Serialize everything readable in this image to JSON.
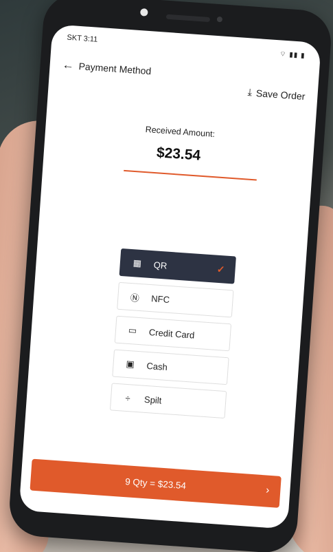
{
  "status_bar": {
    "carrier_time": "SKT 3:11",
    "icons": "⌔ ▮▮ ▮"
  },
  "header": {
    "title": "Payment Method",
    "save_order_label": "Save Order"
  },
  "amount": {
    "label": "Received Amount:",
    "value": "$23.54"
  },
  "methods": [
    {
      "label": "QR",
      "icon": "qr-icon",
      "selected": true
    },
    {
      "label": "NFC",
      "icon": "nfc-icon",
      "selected": false
    },
    {
      "label": "Credit Card",
      "icon": "credit-card-icon",
      "selected": false
    },
    {
      "label": "Cash",
      "icon": "cash-icon",
      "selected": false
    },
    {
      "label": "Spilt",
      "icon": "divide-icon",
      "selected": false
    }
  ],
  "checkout": {
    "label": "9 Qty = $23.54"
  },
  "colors": {
    "accent": "#e05a2b",
    "selected_bg": "#2d3343"
  }
}
